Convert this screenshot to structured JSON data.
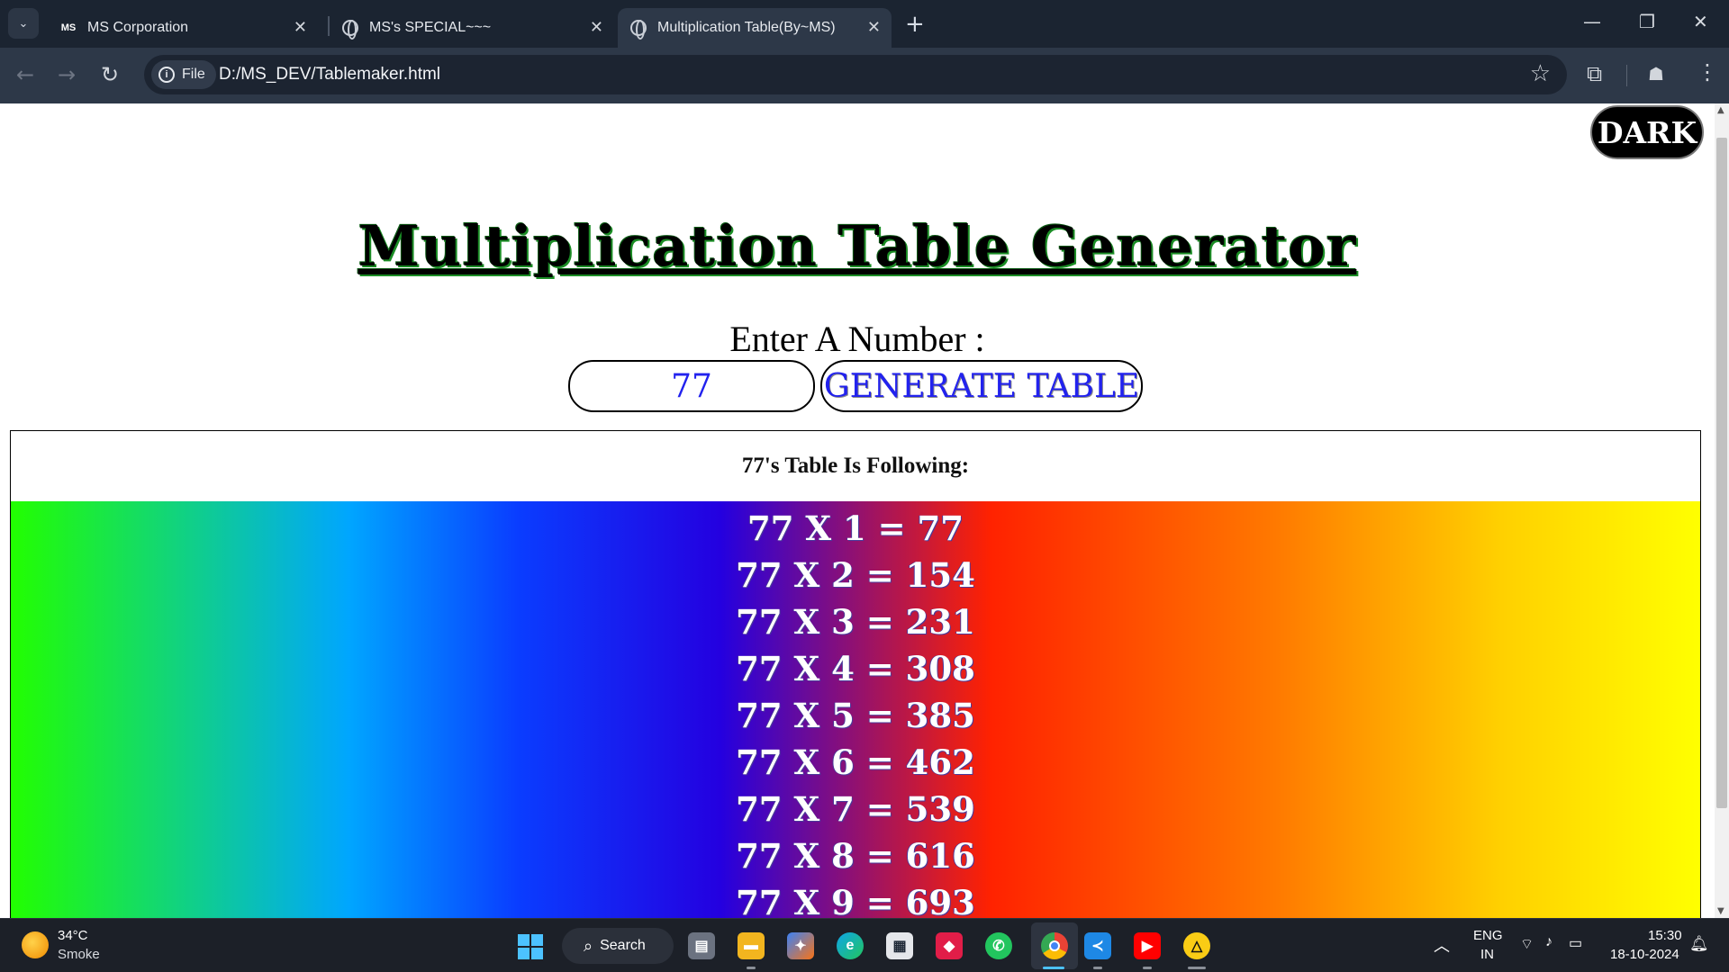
{
  "browser": {
    "tabs": [
      {
        "title": "MS Corporation",
        "favicon": "MS"
      },
      {
        "title": "MS's SPECIAL~~~",
        "favicon": "globe"
      },
      {
        "title": "Multiplication Table(By~MS)",
        "favicon": "globe"
      }
    ],
    "address": {
      "chip_label": "File",
      "url": "D:/MS_DEV/Tablemaker.html"
    }
  },
  "page": {
    "dark_button_label": "DARK",
    "title": "Multiplication Table Generator",
    "prompt_label": "Enter A Number :",
    "input_value": "77",
    "generate_label": "GENERATE TABLE",
    "table_heading": "77's Table Is Following:",
    "rows": [
      "77 X 1 = 77",
      "77 X 2 = 154",
      "77 X 3 = 231",
      "77 X 4 = 308",
      "77 X 5 = 385",
      "77 X 6 = 462",
      "77 X 7 = 539",
      "77 X 8 = 616",
      "77 X 9 = 693"
    ]
  },
  "taskbar": {
    "weather_temp": "34°C",
    "weather_condition": "Smoke",
    "search_label": "Search",
    "lang_top": "ENG",
    "lang_bottom": "IN",
    "time": "15:30",
    "date": "18-10-2024"
  }
}
